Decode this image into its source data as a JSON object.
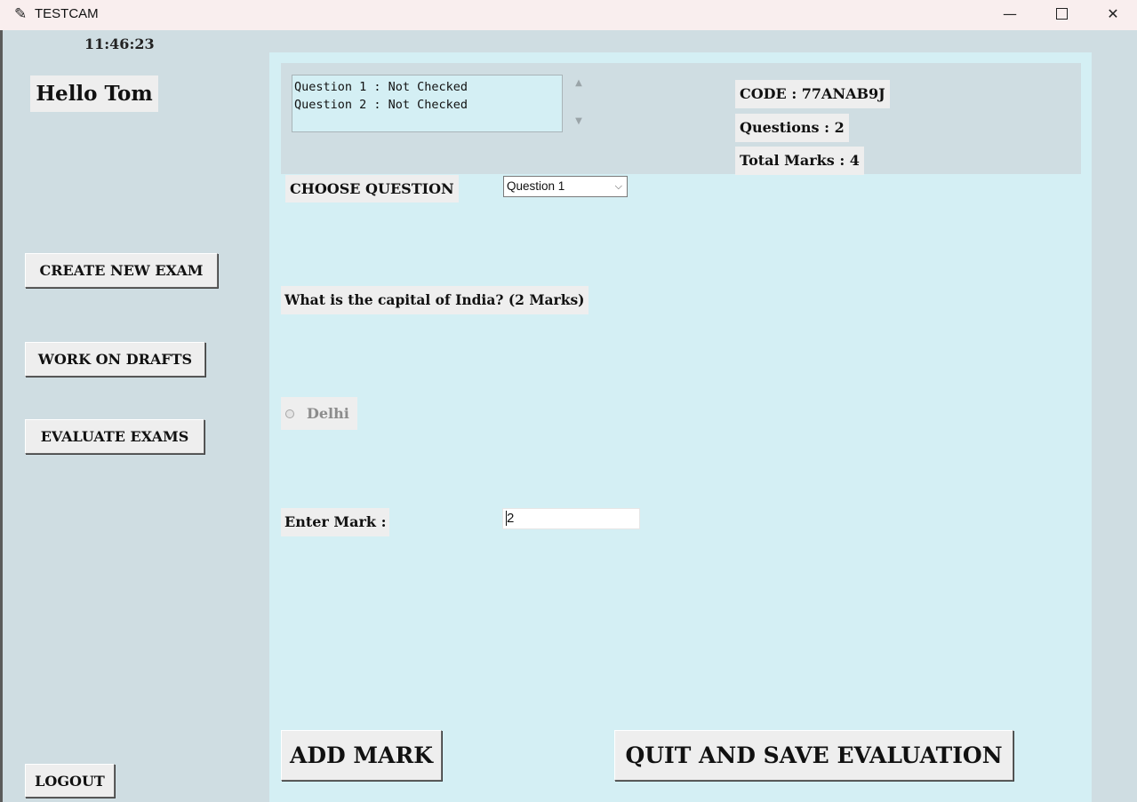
{
  "window": {
    "title": "TESTCAM",
    "minimize_glyph": "—",
    "close_glyph": "✕",
    "app_icon_glyph": "✎"
  },
  "sidebar": {
    "clock": "11:46:23",
    "greeting": "Hello Tom",
    "buttons": {
      "create": "CREATE NEW EXAM",
      "drafts": "WORK ON DRAFTS",
      "evaluate": "EVALUATE EXAMS",
      "logout": "LOGOUT"
    }
  },
  "exam": {
    "status_list": [
      "Question 1 : Not Checked",
      "Question 2 : Not Checked"
    ],
    "code": "CODE : 77ANAB9J",
    "questions": "Questions : 2",
    "total_marks": "Total Marks : 4",
    "choose_label": "CHOOSE QUESTION",
    "selected_question": "Question 1",
    "question_text": "What is the capital of India? (2 Marks)",
    "option": "Delhi",
    "mark_label": "Enter Mark :",
    "mark_value": "2",
    "add_button": "ADD MARK",
    "quit_button": "QUIT AND SAVE EVALUATION"
  },
  "colors": {
    "background": "#cfdde2",
    "panel": "#d4eff4",
    "label_bg": "#eeeeee",
    "titlebar": "#f9eeee"
  }
}
